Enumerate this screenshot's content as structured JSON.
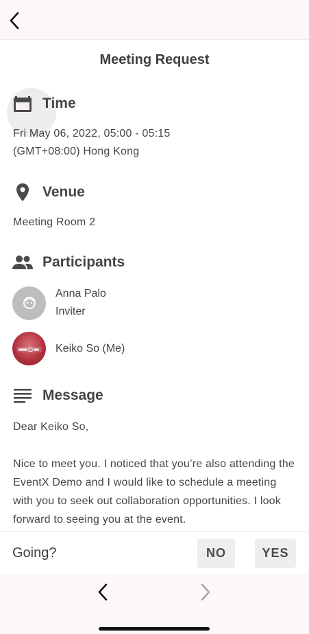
{
  "header": {
    "back_icon": "chevron-left-icon"
  },
  "page": {
    "title": "Meeting Request"
  },
  "time": {
    "heading": "Time",
    "icon": "calendar-icon",
    "datetime": "Fri May 06, 2022, 05:00 - 05:15",
    "timezone": "(GMT+08:00) Hong Kong"
  },
  "venue": {
    "heading": "Venue",
    "icon": "location-pin-icon",
    "value": "Meeting Room 2"
  },
  "participants": {
    "heading": "Participants",
    "icon": "people-icon",
    "items": [
      {
        "name": "Anna Palo",
        "role": "Inviter",
        "avatar": "default-avatar"
      },
      {
        "name": "Keiko So (Me)",
        "role": "",
        "avatar": "eventx-logo-avatar"
      }
    ]
  },
  "message": {
    "heading": "Message",
    "icon": "text-lines-icon",
    "greeting": "Dear Keiko So,",
    "body": "Nice to meet you. I noticed that you’re also attending the EventX Demo and I would like to schedule a meeting with you to seek out collaboration opportunities. I look forward to seeing you at the event."
  },
  "footer": {
    "going_label": "Going?",
    "no_label": "NO",
    "yes_label": "YES"
  },
  "navigation": {
    "back_icon": "chevron-left-icon",
    "forward_icon": "chevron-right-icon"
  },
  "colors": {
    "topbar_bg": "#fcf8fa",
    "text": "#454545",
    "button_bg": "#eeeeee",
    "avatar_grey": "#bdbcbf",
    "avatar_red": "#b3323f"
  }
}
